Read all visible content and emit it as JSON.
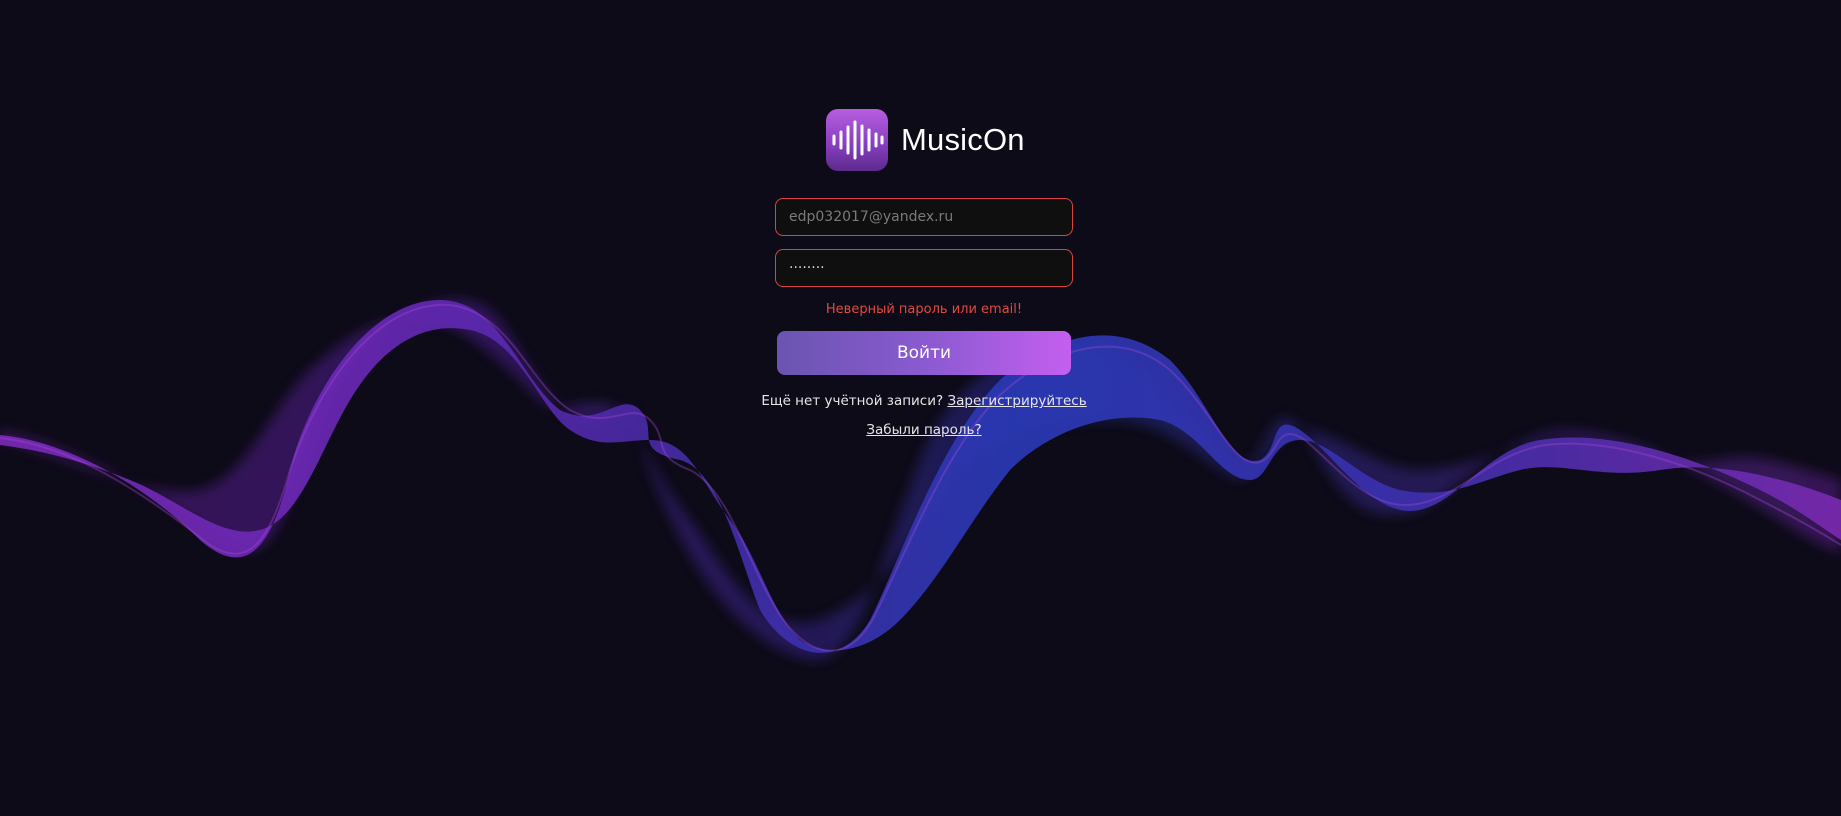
{
  "app": {
    "name": "MusicOn",
    "logo_icon": "soundwave-icon"
  },
  "form": {
    "email_value": "",
    "email_placeholder": "edp032017@yandex.ru",
    "password_value": "········",
    "error_text": "Неверный пароль или email!",
    "submit_label": "Войти",
    "register_prompt": "Ещё нет учётной записи?",
    "register_link": "Зарегистрируйтесь",
    "forgot_link": "Забыли пароль?"
  },
  "colors": {
    "background": "#0d0b18",
    "error": "#e04a3f",
    "field_border": "#d9453d",
    "accent_start": "#6a55b0",
    "accent_end": "#c45fef"
  }
}
